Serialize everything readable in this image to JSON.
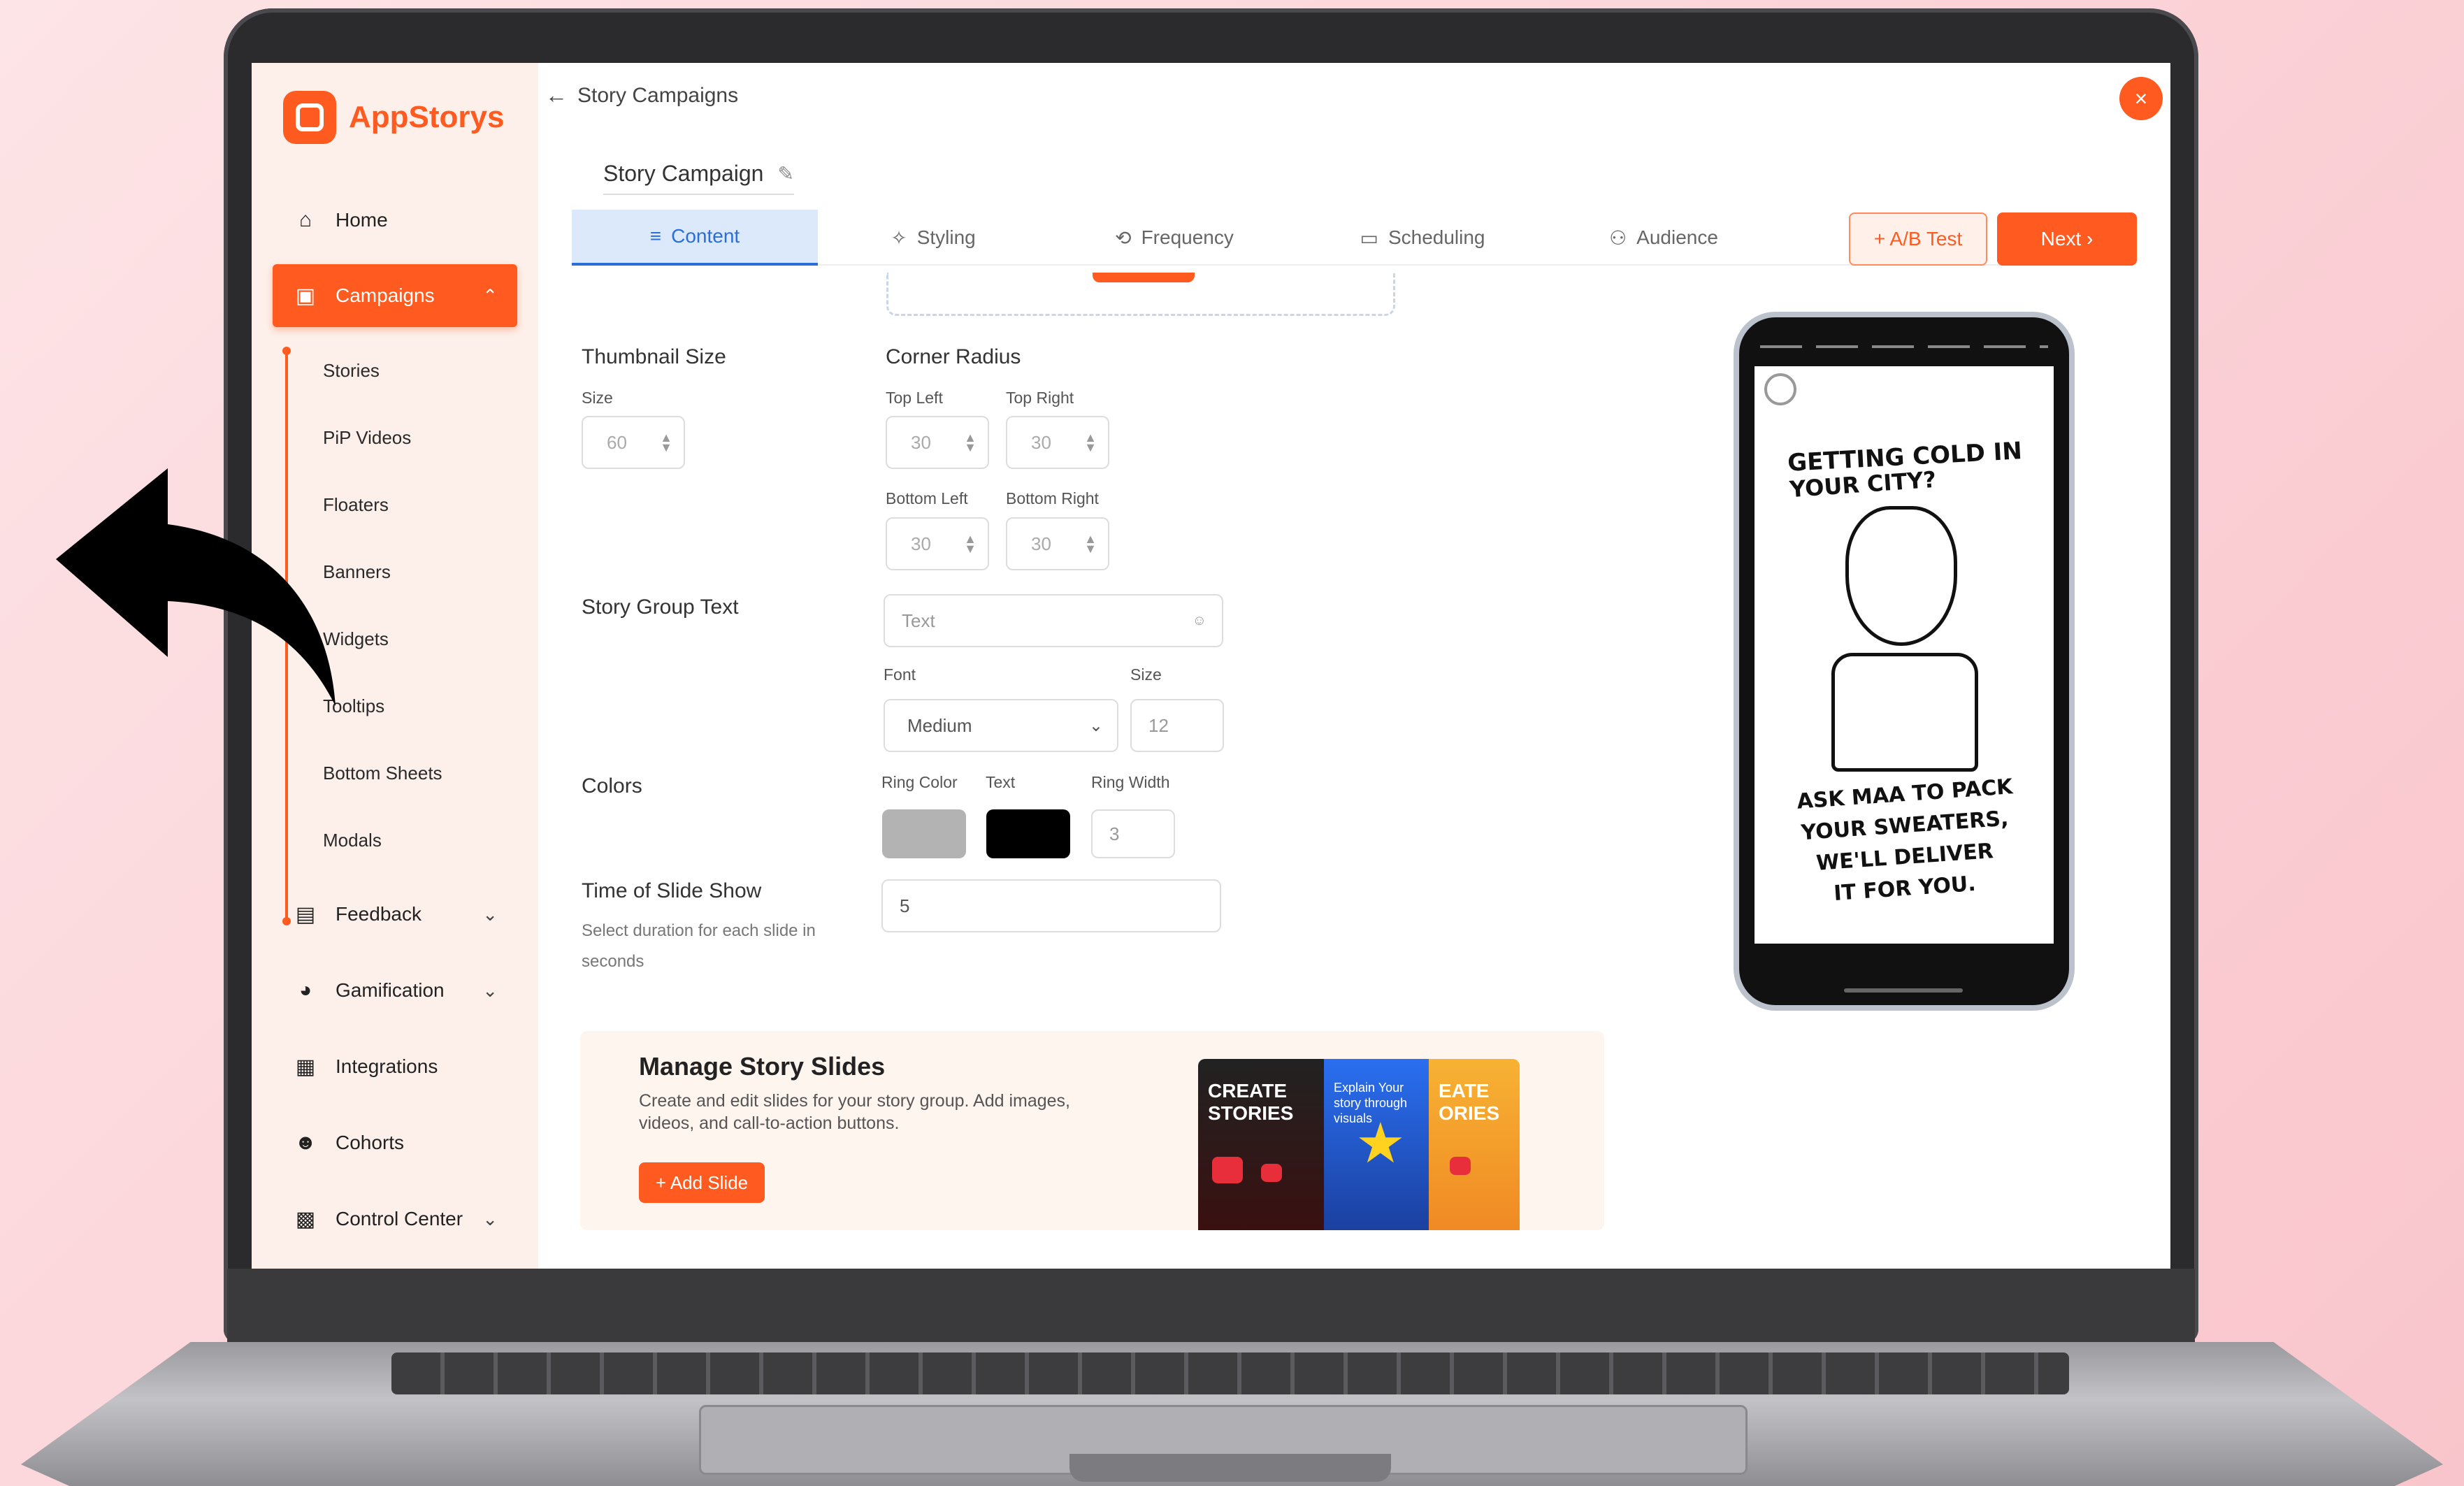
{
  "app": {
    "logo_text": "AppStorys",
    "brand_color": "#ff5a1f"
  },
  "sidebar": {
    "items": [
      {
        "label": "Home",
        "icon": "home-icon"
      },
      {
        "label": "Campaigns",
        "icon": "campaign-icon",
        "active": true
      },
      {
        "label": "Feedback",
        "icon": "clipboard-icon"
      },
      {
        "label": "Gamification",
        "icon": "gamepad-icon"
      },
      {
        "label": "Integrations",
        "icon": "grid-icon"
      },
      {
        "label": "Cohorts",
        "icon": "users-icon"
      },
      {
        "label": "Control Center",
        "icon": "control-icon"
      }
    ],
    "subitems": [
      "Stories",
      "PiP Videos",
      "Floaters",
      "Banners",
      "Widgets",
      "Tooltips",
      "Bottom Sheets",
      "Modals"
    ]
  },
  "header": {
    "back_label": "Story Campaigns",
    "close_label": "×",
    "campaign_name": "Story Campaign"
  },
  "tabs": [
    {
      "label": "Content",
      "icon": "list-icon",
      "active": true
    },
    {
      "label": "Styling",
      "icon": "sparkle-icon"
    },
    {
      "label": "Frequency",
      "icon": "repeat-icon"
    },
    {
      "label": "Scheduling",
      "icon": "calendar-icon"
    },
    {
      "label": "Audience",
      "icon": "users-icon"
    }
  ],
  "actions": {
    "ab_test": "+ A/B Test",
    "next": "Next ›"
  },
  "form": {
    "thumbnail_size": {
      "title": "Thumbnail Size",
      "size_label": "Size",
      "size_value": "60"
    },
    "corner_radius": {
      "title": "Corner Radius",
      "top_left_label": "Top Left",
      "top_left": "30",
      "top_right_label": "Top Right",
      "top_right": "30",
      "bottom_left_label": "Bottom Left",
      "bottom_left": "30",
      "bottom_right_label": "Bottom Right",
      "bottom_right": "30"
    },
    "story_group_text": {
      "title": "Story Group Text",
      "placeholder": "Text",
      "font_label": "Font",
      "font_value": "Medium",
      "size_label": "Size",
      "size_value": "12"
    },
    "colors": {
      "title": "Colors",
      "ring_label": "Ring Color",
      "text_label": "Text",
      "ring_width_label": "Ring Width",
      "ring_width": "3",
      "ring_color": "#b3b3b3",
      "text_color": "#000000"
    },
    "slide_show": {
      "title": "Time of Slide Show",
      "hint": "Select duration for each slide in seconds",
      "value": "5"
    }
  },
  "manage": {
    "title": "Manage Story Slides",
    "description": "Create and edit slides for your story group. Add images, videos, and call-to-action buttons.",
    "add_label": "+ Add Slide",
    "thumb1": "CREATE STORIES",
    "thumb2": "Explain Your story through visuals",
    "thumb3": "EATE ORIES"
  },
  "preview": {
    "line1": "GETTING COLD IN",
    "line2": "YOUR CITY?",
    "line3": "ASK MAA TO PACK",
    "line4": "YOUR SWEATERS,",
    "line5": "WE'LL DELIVER",
    "line6": "IT FOR YOU."
  }
}
